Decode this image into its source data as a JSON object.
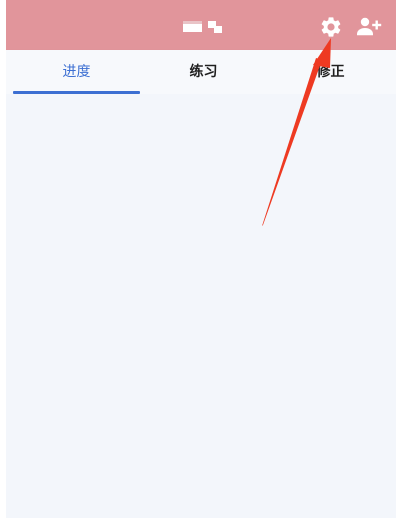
{
  "header": {
    "background_color": "#e1959b",
    "logo_icon": "app-logo",
    "settings_icon": "gear-icon",
    "add_user_icon": "person-add-icon"
  },
  "tabs": [
    {
      "label": "进度",
      "active": true
    },
    {
      "label": "练习",
      "active": false
    },
    {
      "label": "修正",
      "active": false
    }
  ],
  "colors": {
    "accent": "#3c6fd2",
    "content_background": "#f3f6fb",
    "annotation_arrow": "#ee3a22"
  }
}
